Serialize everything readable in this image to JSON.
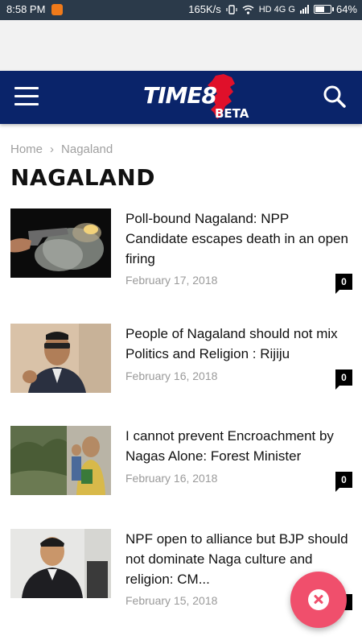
{
  "status_bar": {
    "time": "8:58 PM",
    "network_speed": "165K/s",
    "network_labels": "HD 4G G",
    "battery": "64%",
    "battery_level": 0.64
  },
  "header": {
    "logo_text": "TIME8",
    "logo_badge": "BETA",
    "brand_color": "#0a246a",
    "logo_accent": "#e0102a"
  },
  "breadcrumb": {
    "home": "Home",
    "separator": "›",
    "current": "Nagaland"
  },
  "page_title": "NAGALAND",
  "articles": [
    {
      "title": "Poll-bound Nagaland: NPP Candidate escapes death in an open firing",
      "date": "February 17, 2018",
      "comments": "0",
      "thumbnail": "gun-firing-photo"
    },
    {
      "title": "People of Nagaland should not mix Politics and Religion : Rijiju",
      "date": "February 16, 2018",
      "comments": "0",
      "thumbnail": "speaker-portrait-photo"
    },
    {
      "title": "I cannot prevent Encroachment by Nagas Alone: Forest Minister",
      "date": "February 16, 2018",
      "comments": "0",
      "thumbnail": "forest-minister-photo"
    },
    {
      "title": "NPF open to alliance but BJP should not dominate Naga culture and religion: CM...",
      "date": "February 15, 2018",
      "comments": "0",
      "thumbnail": "chief-minister-photo"
    }
  ],
  "fab": {
    "icon": "close-icon",
    "color": "#f04f6c"
  }
}
